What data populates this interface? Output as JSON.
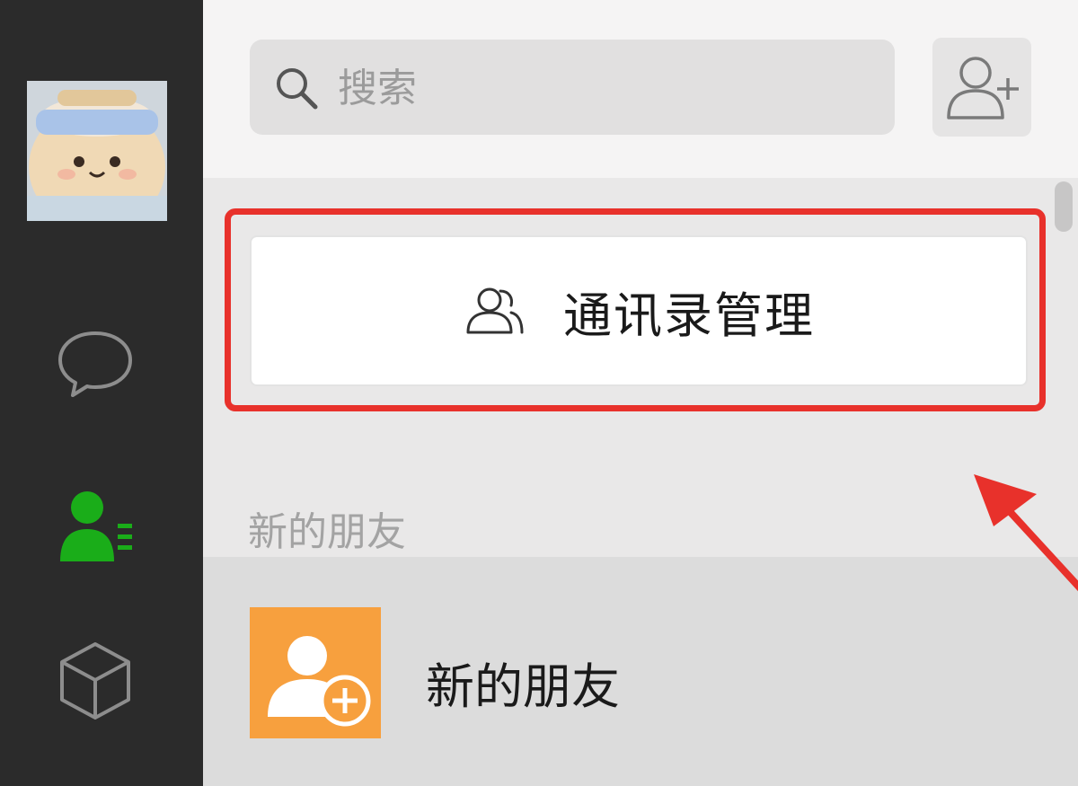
{
  "search": {
    "placeholder": "搜索"
  },
  "contacts_manage": {
    "label": "通讯录管理"
  },
  "new_friends_section": {
    "header": "新的朋友",
    "item_label": "新的朋友"
  },
  "colors": {
    "nav_background": "#2b2b2b",
    "active_icon": "#1aad19",
    "highlight_red": "#e8312b",
    "new_friend_orange": "#f7a03e"
  },
  "icons": {
    "nav": [
      "chat-bubble-icon",
      "contacts-icon",
      "cube-icon"
    ],
    "search": "search-icon",
    "add": "add-contact-icon",
    "manage": "people-outline-icon"
  }
}
